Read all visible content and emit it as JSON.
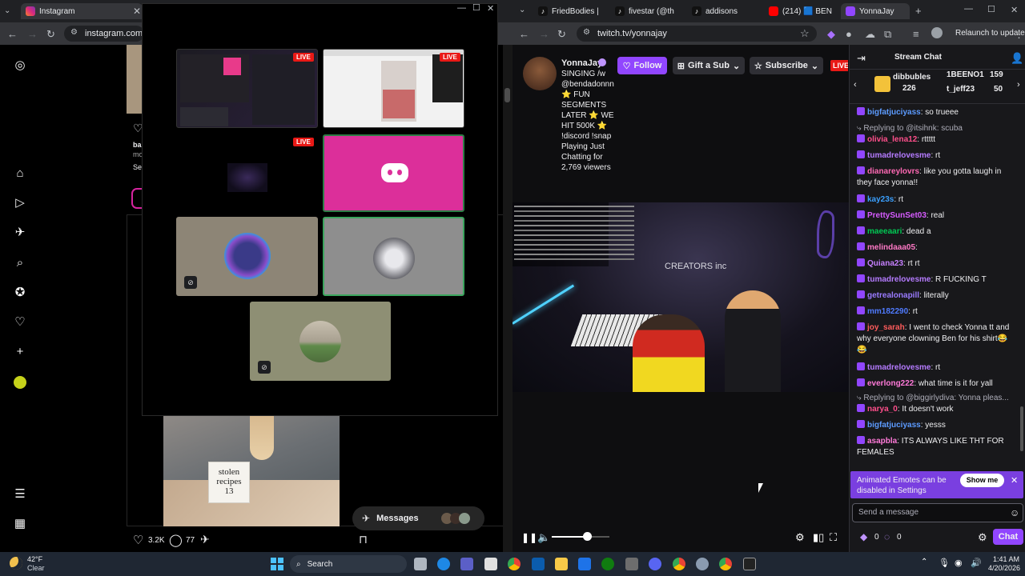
{
  "instagram": {
    "tab_title": "Instagram",
    "url": "instagram.com",
    "post_likes": "3.2K",
    "post_comments": "77",
    "messages_label": "Messages",
    "note_lines": [
      "stolen",
      "recipes",
      "13"
    ],
    "partial_username": "ba",
    "partial_more": "mo",
    "partial_see": "See"
  },
  "discord": {
    "live_badges": [
      "LIVE",
      "LIVE",
      "LIVE"
    ]
  },
  "twitch": {
    "tabs": [
      {
        "label": "FriedBodies |",
        "color": "#ffffff"
      },
      {
        "label": "fivestar (@th",
        "color": "#ffffff"
      },
      {
        "label": "addisons",
        "color": "#ffffff"
      },
      {
        "label": "(214) 🟦 BEN",
        "color": "#ff0000"
      },
      {
        "label": "YonnaJay",
        "color": "#9146ff"
      }
    ],
    "url": "twitch.tv/yonnajay",
    "relaunch": "Relaunch to update",
    "streamer_name": "YonnaJay",
    "stream_title_lines": [
      "SINGING /w",
      "@bendadonnn",
      "⭐ FUN",
      "SEGMENTS",
      "LATER ⭐ WE",
      "HIT 500K ⭐",
      "!discord !snap",
      "Playing Just",
      "Chatting for",
      "2,769 viewers"
    ],
    "follow": "Follow",
    "gift_sub": "Gift a Sub",
    "subscribe": "Subscribe",
    "live": "LIVE",
    "creators_text": "CREATORS inc",
    "stream_chat_title": "Stream Chat",
    "gifters": [
      {
        "name": "dibbubles",
        "count": "226"
      },
      {
        "name": "1BEENO1",
        "count": "159"
      },
      {
        "name": "t_jeff23",
        "count": "50"
      }
    ],
    "chat": [
      {
        "user": "bigfatjuciyass",
        "color": "#5c9bff",
        "msg": ": so trueee"
      },
      {
        "reply": "Replying to @itsihnk: scuba"
      },
      {
        "user": "olivia_lena12",
        "color": "#ff4f8b",
        "msg": ": rttttt"
      },
      {
        "user": "tumadrelovesme",
        "color": "#b57bff",
        "msg": ": rt"
      },
      {
        "user": "dianareylovrs",
        "color": "#ff69b4",
        "msg": ": like you gotta laugh in they face yonna!!"
      },
      {
        "user": "kay23s",
        "color": "#3aa0ff",
        "msg": ": rt"
      },
      {
        "user": "PrettySunSet03",
        "color": "#d65cff",
        "msg": ": real"
      },
      {
        "user": "maeeaari",
        "color": "#00c853",
        "msg": ": dead a"
      },
      {
        "user": "melindaaa05",
        "color": "#ff79c6",
        "msg": ":"
      },
      {
        "user": "Quiana23",
        "color": "#c680ff",
        "msg": ": rt rt"
      },
      {
        "user": "tumadrelovesme",
        "color": "#b57bff",
        "msg": ": R FUCKING T"
      },
      {
        "user": "getrealonapill",
        "color": "#9a7bff",
        "msg": ": literally"
      },
      {
        "user": "mm182290",
        "color": "#4f7bff",
        "msg": ": rt"
      },
      {
        "user": "joy_sarah",
        "color": "#ff5c5c",
        "msg": ": I went to check Yonna tt and why everyone clowning Ben for his shirt😂😂"
      },
      {
        "user": "tumadrelovesme",
        "color": "#b57bff",
        "msg": ": rt"
      },
      {
        "user": "everlong222",
        "color": "#ff7ad9",
        "msg": ": what time is it for yall"
      },
      {
        "reply": "Replying to @biggirlydiva: Yonna pleas..."
      },
      {
        "user": "narya_0",
        "color": "#ff4f8b",
        "msg": ": It doesn't work"
      },
      {
        "user": "bigfatjuciyass",
        "color": "#5c9bff",
        "msg": ": yesss"
      },
      {
        "user": "asapbla",
        "color": "#ff7ad9",
        "msg": ": ITS ALWAYS LIKE THT FOR FEMALES"
      }
    ],
    "notice": "Animated Emotes can be disabled in Settings",
    "show_me": "Show me",
    "send_placeholder": "Send a message",
    "points_a": "0",
    "points_b": "0",
    "chat_button": "Chat"
  },
  "taskbar": {
    "weather_temp": "42°F",
    "weather_desc": "Clear",
    "search": "Search",
    "time": "1:41 AM",
    "date": "4/20/2026"
  },
  "colors": {
    "twitch_purple": "#9146ff",
    "discord_pink": "#dc2f9a",
    "live_red": "#e91916"
  }
}
